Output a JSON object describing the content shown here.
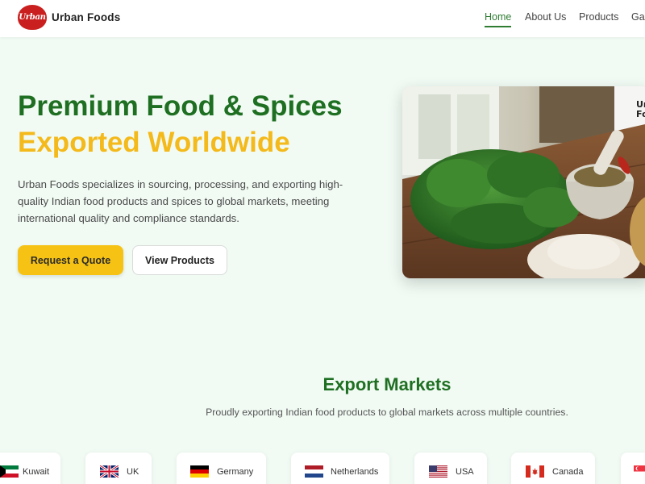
{
  "nav": {
    "logo_text": "Urban",
    "brand": "Urban Foods",
    "links": [
      {
        "label": "Home",
        "active": true
      },
      {
        "label": "About Us",
        "active": false
      },
      {
        "label": "Products",
        "active": false
      },
      {
        "label": "Gal",
        "active": false
      }
    ]
  },
  "hero": {
    "title_line1": "Premium Food & Spices",
    "title_line2": "Exported Worldwide",
    "description": "Urban Foods specializes in sourcing, processing, and exporting high-quality Indian food products and spices to global markets, meeting international quality and compliance standards.",
    "primary_button": "Request a Quote",
    "secondary_button": "View Products",
    "image_jar_text": "Ur\nFo"
  },
  "markets": {
    "title": "Export Markets",
    "subtitle": "Proudly exporting Indian food products to global markets across multiple countries.",
    "countries": [
      "Kuwait",
      "UK",
      "Germany",
      "Netherlands",
      "USA",
      "Canada",
      ""
    ]
  },
  "colors": {
    "primary_green": "#1f6f22",
    "accent_yellow": "#f4b91a",
    "page_bg": "#f1fbf4"
  }
}
